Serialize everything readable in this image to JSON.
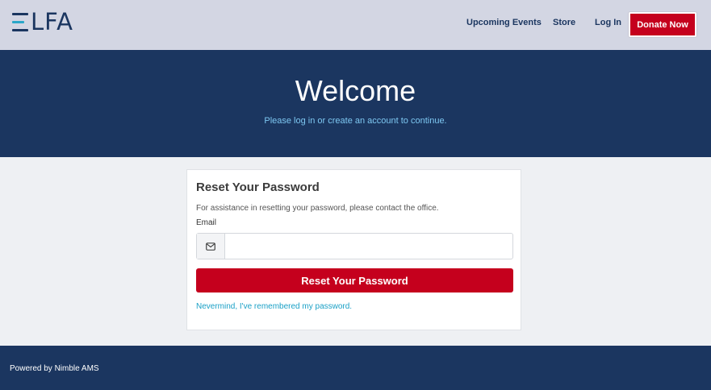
{
  "brand": {
    "logo_text": "LFA",
    "colors": {
      "navy": "#1b3660",
      "red": "#c5001d",
      "teal": "#2aa7c9",
      "link": "#1aa0c6"
    }
  },
  "nav": {
    "upcoming_events": "Upcoming Events",
    "store": "Store",
    "login": "Log In",
    "donate": "Donate Now"
  },
  "hero": {
    "title": "Welcome",
    "subtitle": "Please log in or create an account to continue."
  },
  "form": {
    "title": "Reset Your Password",
    "help": "For assistance in resetting your password, please contact the office.",
    "email_label": "Email",
    "email_value": "",
    "email_placeholder": "",
    "email_icon": "envelope-icon",
    "submit_label": "Reset Your Password",
    "nevermind_link": "Nevermind, I've remembered my password."
  },
  "footer": {
    "text": "Powered by Nimble AMS"
  }
}
